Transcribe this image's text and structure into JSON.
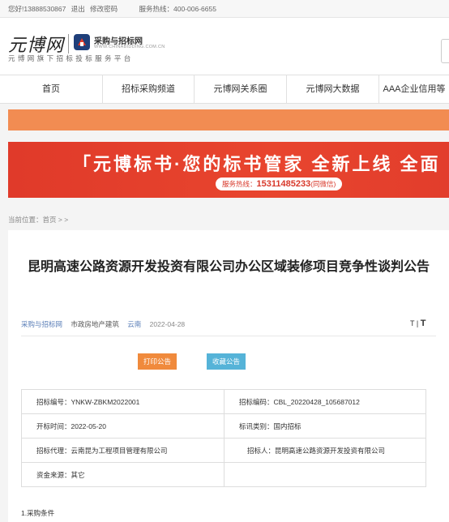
{
  "topbar": {
    "greeting": "您好!13888530867",
    "logout": "退出",
    "change_password": "修改密码",
    "hotline": "服务热线：400-006-6655"
  },
  "header": {
    "logo_text": "元博网",
    "partner_cn": "采购与招标网",
    "partner_en": "WWW.CHINABIDDING.COM.CN",
    "slogan": "元博网旗下招标投标服务平台"
  },
  "nav": {
    "items": [
      "首页",
      "招标采购频道",
      "元博网关系圈",
      "元博网大数据",
      "AAA企业信用等"
    ]
  },
  "banner": {
    "headline": "「元博标书·您的标书管家 全新上线 全面",
    "hotline_label": "服务热线：",
    "hotline_number": "15311485233",
    "hotline_suffix": "(同微信)"
  },
  "breadcrumb": "当前位置：首页 > >",
  "article": {
    "title": "昆明高速公路资源开发投资有限公司办公区域装修项目竞争性谈判公告",
    "source": "采购与招标网",
    "category": "市政房地产建筑",
    "region": "云南",
    "date": "2022-04-28",
    "font_small": "T",
    "font_large": "T",
    "print_button": "打印公告",
    "favorite_button": "收藏公告"
  },
  "info_table": {
    "bid_no": "招标编号：YNKW-ZBKM2022001",
    "bid_code": "招标编码：CBL_20220428_105687012",
    "open_date": "开标时间：2022-05-20",
    "type": "标讯类别：国内招标",
    "agent": "招标代理：云南昆为工程项目管理有限公司",
    "tenderer": "招标人：昆明高速公路资源开发投资有限公司",
    "funding": "资金来源：其它"
  },
  "section_title": "1.采购条件",
  "colors": {
    "accent_orange": "#f08a3c",
    "accent_blue": "#55b3d8",
    "banner_red": "#e03a2a",
    "link_blue": "#5b7fb8"
  }
}
